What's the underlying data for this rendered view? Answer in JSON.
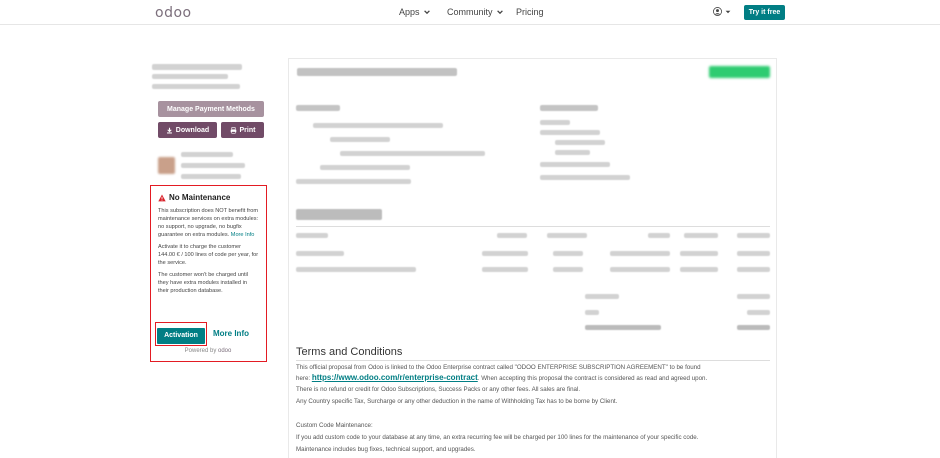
{
  "navbar": {
    "logo": "odoo",
    "apps": "Apps",
    "community": "Community",
    "pricing": "Pricing",
    "try_it_free": "Try it free"
  },
  "sidebar": {
    "manage_payment_methods": "Manage Payment Methods",
    "download": "Download",
    "print": "Print"
  },
  "maintenance": {
    "title": "No Maintenance",
    "paragraph1": "This subscription does NOT benefit from maintenance services on extra modules: no support, no upgrade, no bugfix guarantee on extra modules.",
    "more_info_inline": "More Info",
    "paragraph2": "Activate it to charge the customer 144.00 € / 100 lines of code per year, for the service.",
    "paragraph3": "The customer won't be charged until they have extra modules installed in their production database.",
    "activation_button": "Activation",
    "more_info_link": "More Info",
    "powered_by": "Powered by",
    "powered_brand": "odoo"
  },
  "terms": {
    "title": "Terms and Conditions",
    "line1": "This official proposal from Odoo is linked to the Odoo Enterprise contract called \"ODOO ENTERPRISE SUBSCRIPTION AGREEMENT\" to be found",
    "line2_prefix": "here: ",
    "link": "https://www.odoo.com/r/enterprise-contract",
    "line2_suffix": ". When accepting this proposal the contract is considered as read and agreed upon.",
    "line3": "There is no refund or credit for Odoo Subscriptions, Success Packs or any other fees. All sales are final.",
    "line4": "Any Country specific Tax, Surcharge or any other deduction in the name of Withholding Tax has to be borne by Client.",
    "line5": "Custom Code Maintenance:",
    "line6": "If you add custom code to your database at any time, an extra recurring fee will be charged per 100 lines for the maintenance of your specific code.",
    "line7": "Maintenance includes bug fixes, technical support, and upgrades."
  },
  "colors": {
    "brand_purple": "#714b67",
    "teal": "#017e84",
    "alert_red": "#e31b23"
  }
}
